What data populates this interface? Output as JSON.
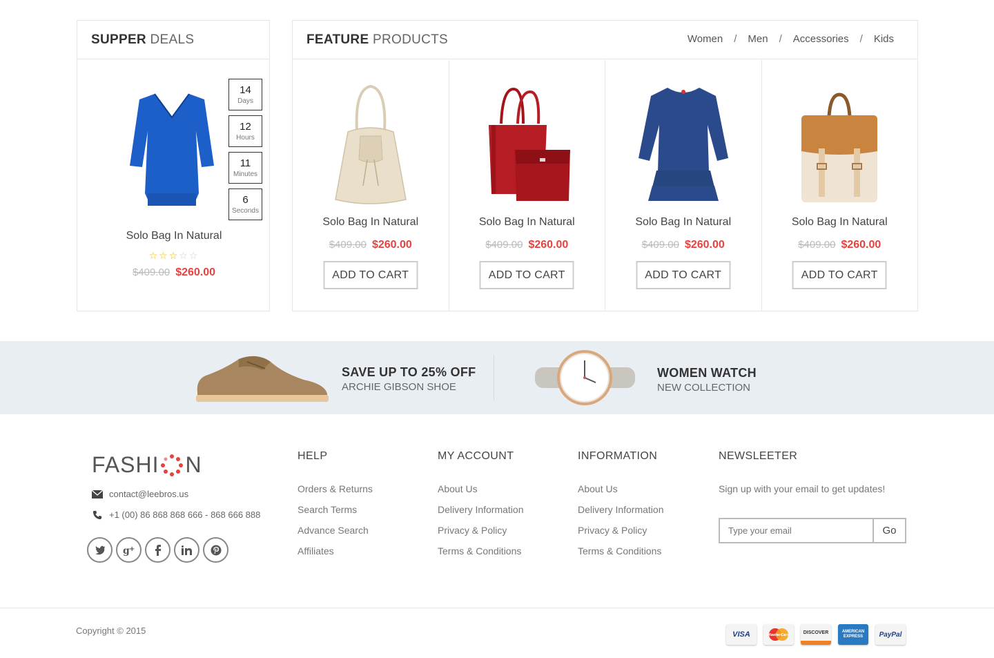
{
  "deals": {
    "title_bold": "SUPPER",
    "title_light": "DEALS",
    "countdown": [
      {
        "num": "14",
        "unit": "Days"
      },
      {
        "num": "12",
        "unit": "Hours"
      },
      {
        "num": "11",
        "unit": "Minutes"
      },
      {
        "num": "6",
        "unit": "Seconds"
      }
    ],
    "product": {
      "name": "Solo Bag In Natural",
      "rating": 3,
      "rating_max": 5,
      "old_price": "$409.00",
      "new_price": "$260.00"
    }
  },
  "feature": {
    "title_bold": "FEATURE",
    "title_light": "PRODUCTS",
    "categories": [
      "Women",
      "Men",
      "Accessories",
      "Kids"
    ],
    "separator": "/",
    "products": [
      {
        "name": "Solo Bag In Natural",
        "old_price": "$409.00",
        "new_price": "$260.00",
        "button": "ADD TO CART",
        "icon": "bucket-bag-icon"
      },
      {
        "name": "Solo Bag In Natural",
        "old_price": "$409.00",
        "new_price": "$260.00",
        "button": "ADD TO CART",
        "icon": "tote-bag-icon"
      },
      {
        "name": "Solo Bag In Natural",
        "old_price": "$409.00",
        "new_price": "$260.00",
        "button": "ADD TO CART",
        "icon": "dress-icon"
      },
      {
        "name": "Solo Bag In Natural",
        "old_price": "$409.00",
        "new_price": "$260.00",
        "button": "ADD TO CART",
        "icon": "backpack-icon"
      }
    ]
  },
  "banner": {
    "left": {
      "title": "SAVE UP TO 25% OFF",
      "subtitle": "ARCHIE GIBSON SHOE"
    },
    "right": {
      "title": "WOMEN WATCH",
      "subtitle": "NEW COLLECTION"
    }
  },
  "footer": {
    "logo_left": "FASHI",
    "logo_right": "N",
    "email": "contact@leebros.us",
    "phone": "+1 (00) 86 868 868 666 - 868 666 888",
    "socials": [
      "twitter-icon",
      "google-plus-icon",
      "facebook-icon",
      "linkedin-icon",
      "pinterest-icon"
    ],
    "help": {
      "title": "HELP",
      "links": [
        "Orders & Returns",
        "Search Terms",
        "Advance Search",
        "Affiliates"
      ]
    },
    "account": {
      "title": "MY ACCOUNT",
      "links": [
        "About Us",
        "Delivery Information",
        "Privacy & Policy",
        "Terms & Conditions"
      ]
    },
    "information": {
      "title": "INFORMATION",
      "links": [
        "About Us",
        "Delivery Information",
        "Privacy & Policy",
        "Terms & Conditions"
      ]
    },
    "newsletter": {
      "title": "NEWSLEETER",
      "text": "Sign up with your email to get updates!",
      "placeholder": "Type your email",
      "button": "Go"
    },
    "copyright": "Copyright © 2015",
    "payments": [
      "VISA",
      "MasterCard",
      "DISCOVER",
      "AMERICAN EXPRESS",
      "PayPal"
    ]
  },
  "colors": {
    "accent": "#e8413e",
    "star": "#f0b400",
    "banner_bg": "#e9eef3"
  }
}
